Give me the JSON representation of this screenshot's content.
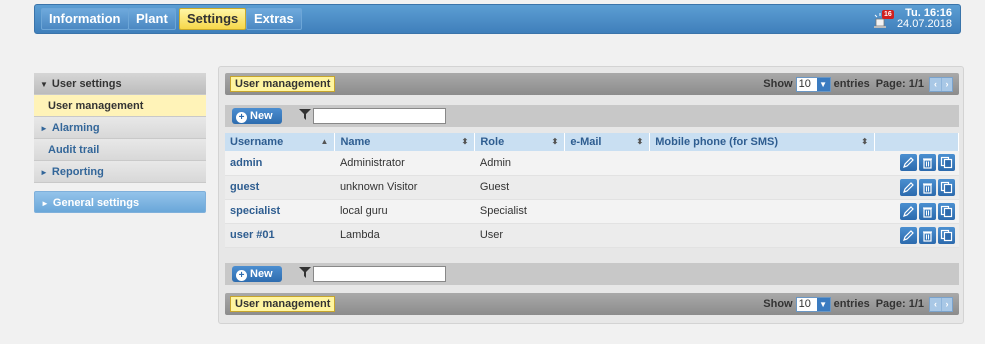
{
  "nav": {
    "tabs": [
      {
        "label": "Information",
        "active": false
      },
      {
        "label": "Plant",
        "active": false
      },
      {
        "label": "Settings",
        "active": true
      },
      {
        "label": "Extras",
        "active": false
      }
    ],
    "alarm_count": "16",
    "time": "Tu. 16:16",
    "date": "24.07.2018"
  },
  "sidebar": {
    "items": [
      {
        "label": "User settings",
        "type": "header",
        "icon": "caret-down-icon"
      },
      {
        "label": "User management",
        "type": "active"
      },
      {
        "label": "Alarming",
        "type": "collapsed",
        "icon": "caret-right-icon"
      },
      {
        "label": "Audit trail",
        "type": "sub"
      },
      {
        "label": "Reporting",
        "type": "collapsed",
        "icon": "caret-right-icon"
      },
      {
        "label": "General settings",
        "type": "blue",
        "icon": "caret-right-icon"
      }
    ]
  },
  "panel": {
    "title": "User management",
    "show_label": "Show",
    "entries_value": "10",
    "entries_label": "entries",
    "page_label": "Page: 1/1",
    "new_label": "New",
    "filter_value": "",
    "columns": [
      "Username",
      "Name",
      "Role",
      "e-Mail",
      "Mobile phone (for SMS)"
    ],
    "rows": [
      {
        "username": "admin",
        "name": "Administrator",
        "role": "Admin",
        "email": "",
        "phone": ""
      },
      {
        "username": "guest",
        "name": "unknown Visitor",
        "role": "Guest",
        "email": "",
        "phone": ""
      },
      {
        "username": "specialist",
        "name": "local guru",
        "role": "Specialist",
        "email": "",
        "phone": ""
      },
      {
        "username": "user #01",
        "name": "Lambda",
        "role": "User",
        "email": "",
        "phone": ""
      }
    ]
  },
  "colors": {
    "accent": "#3f7fbb",
    "active_tab": "#f6d74a",
    "highlight": "#fff5a0"
  }
}
